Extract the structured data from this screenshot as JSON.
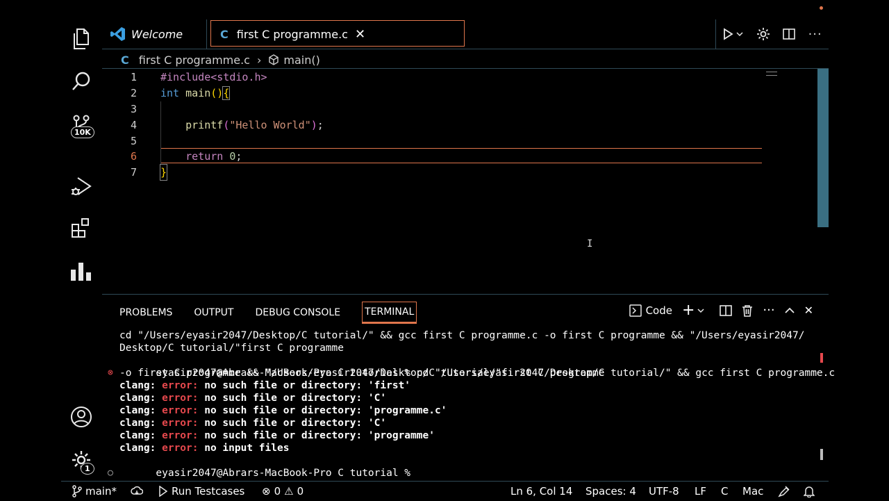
{
  "colors": {
    "accent": "#e0764c",
    "error": "#e5484d",
    "c_icon": "#5aa8d6",
    "scrollbar": "#3a6f82"
  },
  "activity_bar": {
    "items": [
      "explorer-icon",
      "search-icon",
      "source-control-icon",
      "run-debug-icon",
      "extensions-icon",
      "stats-icon"
    ],
    "source_control_badge": "10K",
    "manage_badge": "1"
  },
  "tabs": [
    {
      "label": "Welcome",
      "icon": "vscode-logo-icon",
      "active": false
    },
    {
      "label": "first C programme.c",
      "icon": "C",
      "active": true
    }
  ],
  "breadcrumb": {
    "icon": "C",
    "file": "first C programme.c",
    "symbol": "main()"
  },
  "editor": {
    "lines": [
      {
        "n": "1",
        "text": "#include<stdio.h>"
      },
      {
        "n": "2",
        "text": "int main(){"
      },
      {
        "n": "3",
        "text": ""
      },
      {
        "n": "4",
        "text": "    printf(\"Hello World\");"
      },
      {
        "n": "5",
        "text": ""
      },
      {
        "n": "6",
        "text": "    return 0;"
      },
      {
        "n": "7",
        "text": "}"
      }
    ],
    "current_line": 6
  },
  "panel": {
    "tabs": [
      "PROBLEMS",
      "OUTPUT",
      "DEBUG CONSOLE",
      "TERMINAL"
    ],
    "active_tab": "TERMINAL",
    "terminal_profile": "Code",
    "terminal": {
      "cmd_line1": "cd \"/Users/eyasir2047/Desktop/C tutorial/\" && gcc first C programme.c -o first C programme && \"/Users/eyasir2047/",
      "cmd_line2": "Desktop/C tutorial/\"first C programme",
      "prompt1": "eyasir2047@Abrars-MacBook-Pro C tutorial % cd \"/Users/eyasir2047/Desktop/C tutorial/\" && gcc first C programme.c",
      "prompt1_cont": "-o first C programme && \"/Users/eyasir2047/Desktop/C tutorial/\"first C programme",
      "clang_prefix": "clang: ",
      "error_word": "error:",
      "errors": [
        " no such file or directory: 'first'",
        " no such file or directory: 'C'",
        " no such file or directory: 'programme.c'",
        " no such file or directory: 'C'",
        " no such file or directory: 'programme'",
        " no input files"
      ],
      "prompt2": "eyasir2047@Abrars-MacBook-Pro C tutorial %"
    }
  },
  "statusbar": {
    "branch": "main*",
    "run_testcases": "Run Testcases",
    "errors": "0",
    "warnings": "0",
    "position": "Ln 6, Col 14",
    "spaces": "Spaces: 4",
    "encoding": "UTF-8",
    "eol": "LF",
    "language": "C",
    "keymap": "Mac"
  }
}
